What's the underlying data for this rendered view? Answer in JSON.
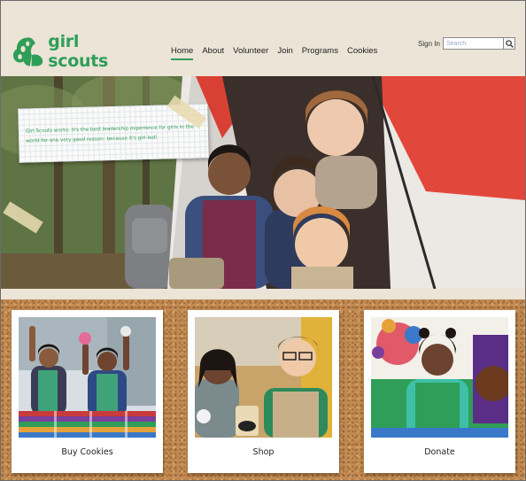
{
  "brand": {
    "logo_text": "girl scouts"
  },
  "nav": [
    {
      "label": "Home",
      "active": true
    },
    {
      "label": "About",
      "active": false
    },
    {
      "label": "Volunteer",
      "active": false
    },
    {
      "label": "Join",
      "active": false
    },
    {
      "label": "Programs",
      "active": false
    },
    {
      "label": "Cookies",
      "active": false
    }
  ],
  "account": {
    "signin_label": "Sign In"
  },
  "search": {
    "placeholder": "Search",
    "value": ""
  },
  "hero": {
    "note_text": "Girl Scouts works. It's the best leadership experience for girls in the world for one very good reason: because it's girl-led!"
  },
  "cards": [
    {
      "label": "Buy Cookies"
    },
    {
      "label": "Shop"
    },
    {
      "label": "Donate"
    }
  ],
  "colors": {
    "brand_green": "#2f9e58",
    "header_bg": "#ece4d7",
    "cork": "#c28a52",
    "tent_red": "#e2473b"
  },
  "icons": [
    "trefoil-logo-icon",
    "search-icon"
  ]
}
